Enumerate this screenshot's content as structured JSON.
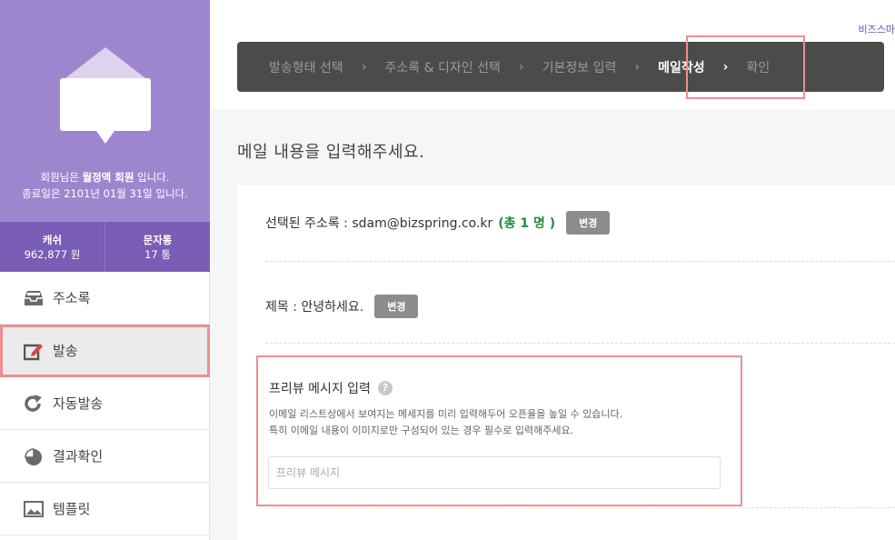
{
  "top_link": "비즈스마",
  "profile": {
    "line1_prefix": "회원님은 ",
    "line1_grade": "월정액 회원",
    "line1_suffix": " 입니다.",
    "line2": "종료일은 2101년 01월 31일 입니다."
  },
  "stats": [
    {
      "label": "캐쉬",
      "value": "962,877 원"
    },
    {
      "label": "문자통",
      "value": "17 통"
    }
  ],
  "nav": [
    {
      "label": "주소록",
      "icon": "inbox-tray-icon"
    },
    {
      "label": "발송",
      "icon": "edit-pencil-icon"
    },
    {
      "label": "자동발송",
      "icon": "refresh-icon"
    },
    {
      "label": "결과확인",
      "icon": "pie-chart-icon"
    },
    {
      "label": "템플릿",
      "icon": "image-icon"
    }
  ],
  "steps": [
    "발송형태 선택",
    "주소록 & 디자인 선택",
    "기본정보 입력",
    "메일작성",
    "확인"
  ],
  "main_title": "메일 내용을 입력해주세요.",
  "address": {
    "prefix": "선택된 주소록 : sdam@bizspring.co.kr",
    "count": "(총 1 명 )",
    "button": "변경"
  },
  "subject": {
    "text": "제목 : 안녕하세요.",
    "button": "변경"
  },
  "preview": {
    "title": "프리뷰 메시지 입력",
    "help": "?",
    "desc1": "이메일 리스트상에서 보여지는 메세지를 미리 입력해두어 오픈율을 높일 수 있습니다.",
    "desc2": "특히 이메일 내용이 이미지로만 구성되어 있는 경우 필수로 입력해주세요.",
    "placeholder": "프리뷰 메시지"
  }
}
